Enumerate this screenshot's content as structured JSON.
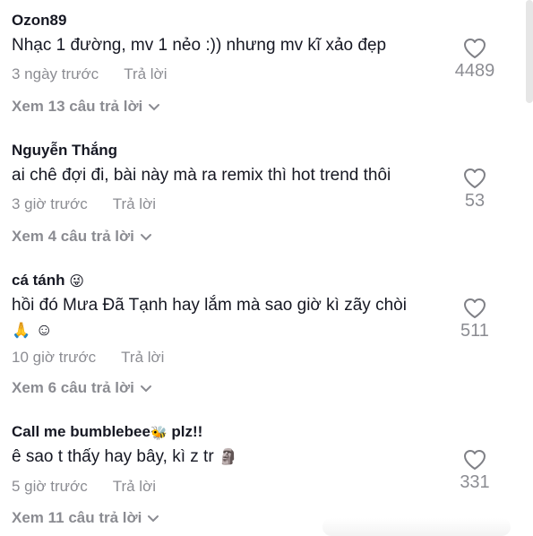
{
  "comments": [
    {
      "username": "Ozon89",
      "text": "Nhạc 1 đường, mv 1 nẻo :)) nhưng mv kĩ xảo đẹp",
      "time": "3 ngày trước",
      "reply_label": "Trả lời",
      "view_replies": "Xem 13 câu trả lời",
      "likes": "4489"
    },
    {
      "username": "Nguyễn Thắng",
      "text": "ai chê đợi đi, bài này mà ra remix thì hot trend thôi",
      "time": "3 giờ trước",
      "reply_label": "Trả lời",
      "view_replies": "Xem 4 câu trả lời",
      "likes": "53"
    },
    {
      "username": "cá tánh",
      "username_emoji": "😜",
      "text": "hồi đó Mưa Đã Tạnh hay lắm mà sao giờ kì zãy chòi",
      "text_line2": "☺",
      "text_line2_emoji": "🙏",
      "time": "10 giờ trước",
      "reply_label": "Trả lời",
      "view_replies": "Xem 6 câu trả lời",
      "likes": "511"
    },
    {
      "username": "Call me bumblebee",
      "username_suffix": "plz!!",
      "username_emoji": "🐝",
      "text": "ê sao t thấy hay bây, kì z tr",
      "text_emoji": "🗿",
      "time": "5 giờ trước",
      "reply_label": "Trả lời",
      "view_replies": "Xem 11 câu trả lời",
      "likes": "331"
    }
  ],
  "icons": {
    "like": "heart-outline-icon",
    "expand": "chevron-down-icon"
  },
  "colors": {
    "primary_text": "#161823",
    "secondary_text": "rgba(22,24,35,0.5)"
  }
}
